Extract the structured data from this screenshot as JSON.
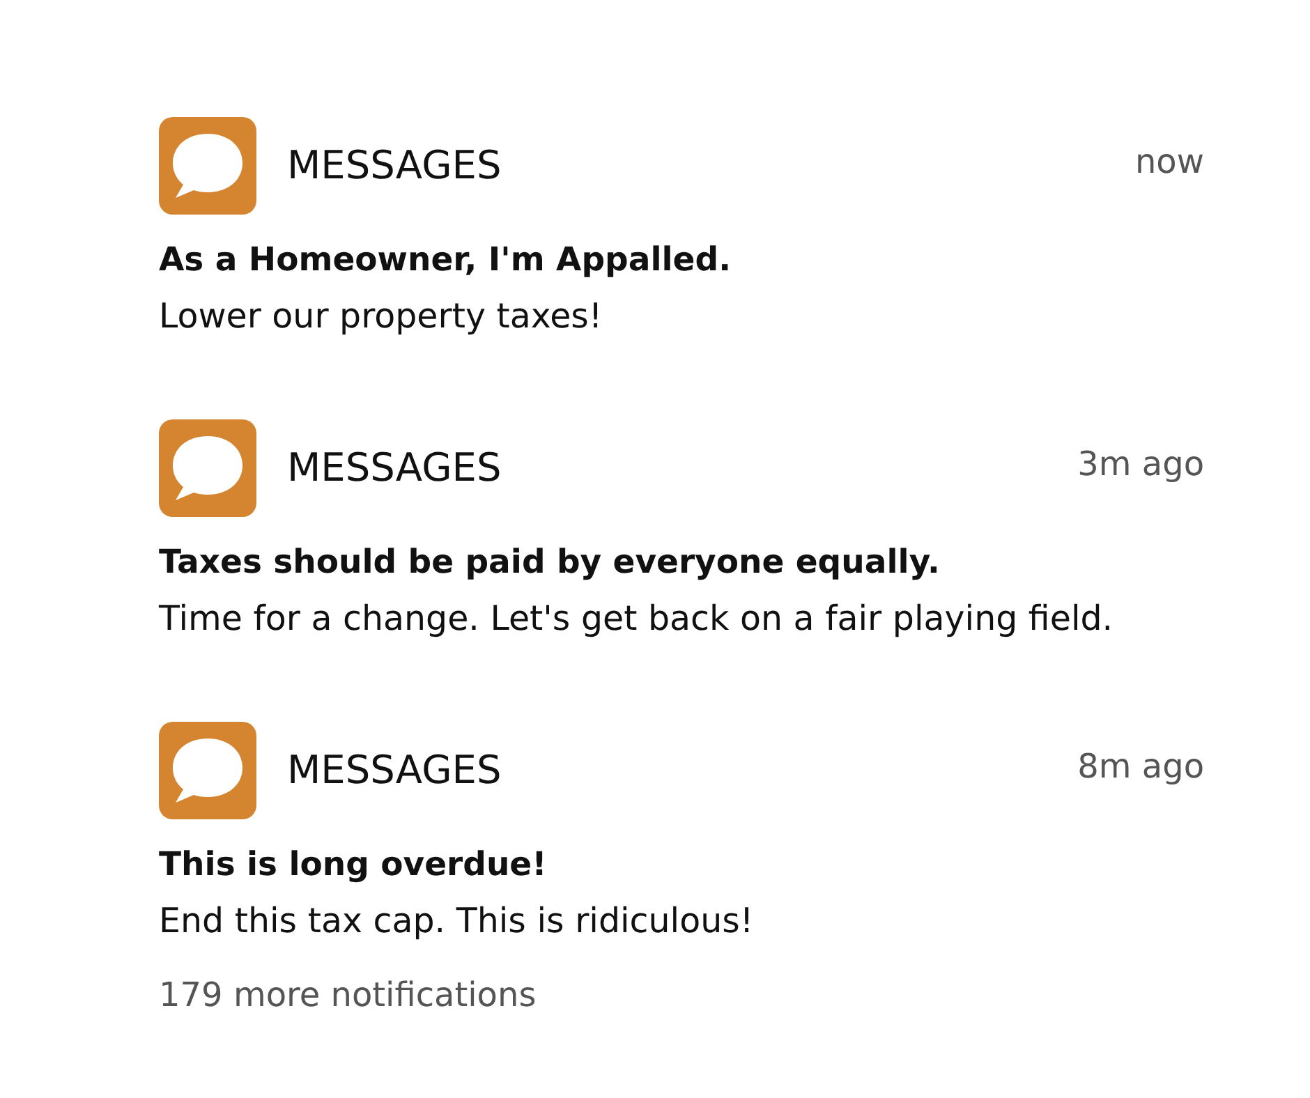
{
  "notifications": [
    {
      "app": "MESSAGES",
      "time": "now",
      "title": "As a Homeowner, I'm Appalled.",
      "body": "Lower our property taxes!"
    },
    {
      "app": "MESSAGES",
      "time": "3m ago",
      "title": "Taxes should be paid by everyone equally.",
      "body": "Time for a change. Let's get back on a fair playing field."
    },
    {
      "app": "MESSAGES",
      "time": "8m ago",
      "title": "This is long overdue!",
      "body": "End this tax cap. This is ridiculous!"
    }
  ],
  "more": "179 more notifications"
}
